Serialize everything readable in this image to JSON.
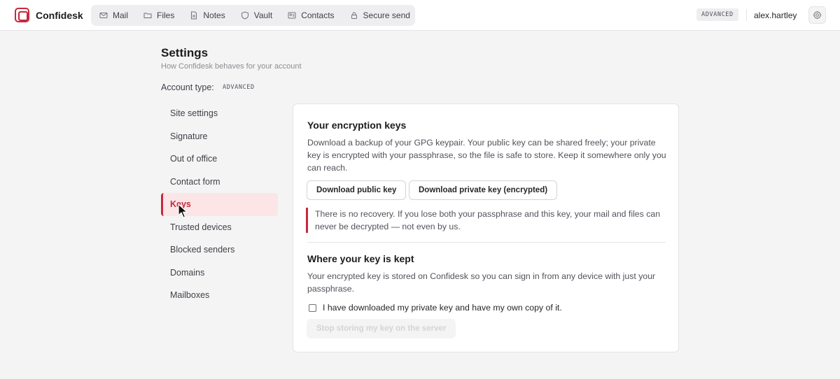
{
  "app": {
    "name": "Confidesk"
  },
  "nav": [
    {
      "label": "Mail",
      "icon": "mail-icon"
    },
    {
      "label": "Files",
      "icon": "folder-icon"
    },
    {
      "label": "Notes",
      "icon": "note-icon"
    },
    {
      "label": "Vault",
      "icon": "shield-icon"
    },
    {
      "label": "Contacts",
      "icon": "contacts-icon"
    },
    {
      "label": "Secure send",
      "icon": "lock-icon"
    }
  ],
  "topbar": {
    "badge": "ADVANCED",
    "user": "alex.hartley",
    "settings_icon": "gear-icon"
  },
  "page": {
    "title": "Settings",
    "subtitle": "How Confidesk behaves for your account",
    "account_type_label": "Account type:",
    "account_type_value": "ADVANCED"
  },
  "sidebar": {
    "items": [
      {
        "label": "Site settings"
      },
      {
        "label": "Signature"
      },
      {
        "label": "Out of office"
      },
      {
        "label": "Contact form"
      },
      {
        "label": "Keys",
        "active": true
      },
      {
        "label": "Trusted devices"
      },
      {
        "label": "Blocked senders"
      },
      {
        "label": "Domains"
      },
      {
        "label": "Mailboxes"
      }
    ]
  },
  "keys": {
    "heading": "Your encryption keys",
    "description": "Download a backup of your GPG keypair. Your public key can be shared freely; your private key is encrypted with your passphrase, so the file is safe to store. Keep it somewhere only you can reach.",
    "download_public_label": "Download public key",
    "download_private_label": "Download private key (encrypted)",
    "warning": "There is no recovery. If you lose both your passphrase and this key, your mail and files can never be decrypted — not even by us.",
    "storage_heading": "Where your key is kept",
    "storage_description": "Your encrypted key is stored on Confidesk so you can sign in from any device with just your passphrase.",
    "checkbox_label": "I have downloaded my private key and have my own copy of it.",
    "checkbox_checked": false,
    "stop_storing_label": "Stop storing my key on the server",
    "stop_storing_disabled": true
  },
  "colors": {
    "accent": "#c8283e",
    "active_bg": "#fbe5e7",
    "page_bg": "#f4f4f5"
  }
}
